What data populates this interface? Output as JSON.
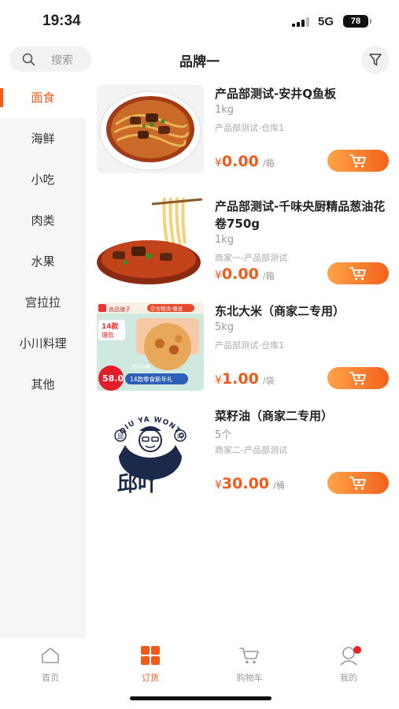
{
  "status_bar": {
    "time": "19:34",
    "network": "5G",
    "battery": "78"
  },
  "header": {
    "search_placeholder": "搜索",
    "title": "品牌一"
  },
  "sidebar": {
    "categories": [
      {
        "label": "面食",
        "active": true
      },
      {
        "label": "海鲜"
      },
      {
        "label": "小吃"
      },
      {
        "label": "肉类"
      },
      {
        "label": "水果"
      },
      {
        "label": "宫拉拉"
      },
      {
        "label": "小川料理"
      },
      {
        "label": "其他"
      }
    ]
  },
  "products": [
    {
      "name": "产品部测试-安井Q鱼板",
      "spec": "1kg",
      "shop": "产品部测试-仓库1",
      "currency": "¥",
      "price": "0.00",
      "unit": "/箱",
      "image": "beef-noodle-bowl"
    },
    {
      "name": "产品部测试-千味央厨精品葱油花卷750g",
      "spec": "1kg",
      "shop": "商家一-产品部测试",
      "currency": "¥",
      "price": "0.00",
      "unit": "/箱",
      "image": "noodle-soup-chopsticks"
    },
    {
      "name": "东北大米（商家二专用）",
      "spec": "5kg",
      "shop": "产品部测试-仓库1",
      "currency": "¥",
      "price": "1.00",
      "unit": "/袋",
      "image": "promo-food-box",
      "image_text": {
        "badge_top": "14款",
        "badge_mid": "爆款",
        "price_tag": "58.0",
        "banner": "14款零食新年礼",
        "brand": "良品铺子",
        "strip": "京仓物流·赠送",
        "sub_tag": "到手价格"
      }
    },
    {
      "name": "菜籽油（商家二专用）",
      "spec": "5个",
      "shop": "商家二-产品部测试",
      "currency": "¥",
      "price": "30.00",
      "unit": "/桶",
      "image": "qiuya-wonton-logo",
      "image_text": {
        "arc": "QIU YA WONTON",
        "seal_left": "邱",
        "seal_right": "吖",
        "brand_cn": "邱吖"
      }
    }
  ],
  "tabbar": {
    "tabs": [
      {
        "label": "首页",
        "icon": "home-icon"
      },
      {
        "label": "订货",
        "icon": "grid-icon",
        "active": true
      },
      {
        "label": "购物车",
        "icon": "cart-icon"
      },
      {
        "label": "我的",
        "icon": "user-icon",
        "badge": true
      }
    ]
  },
  "colors": {
    "accent": "#f05a1a",
    "button_start": "#ffa348",
    "button_end": "#f2621d",
    "sidebar_bg": "#f6f6f6",
    "badge": "#e8252a"
  }
}
